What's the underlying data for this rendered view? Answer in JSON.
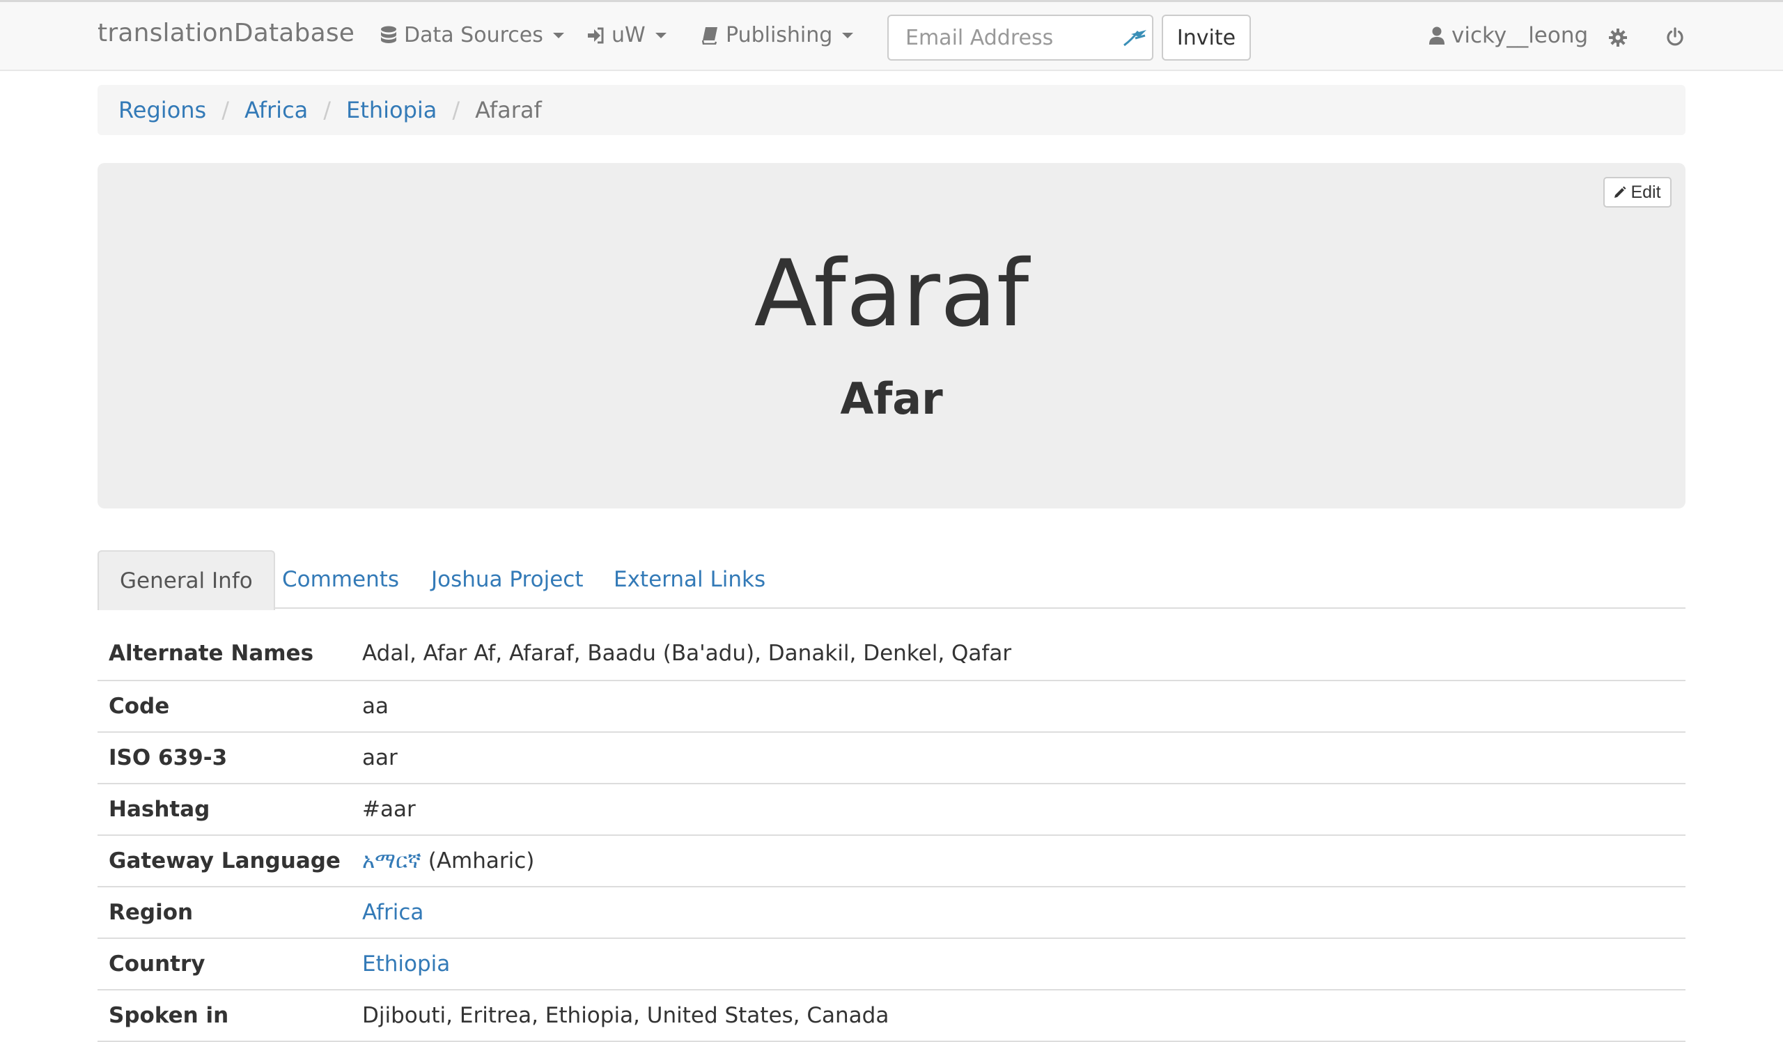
{
  "navbar": {
    "brand": "translationDatabase",
    "menus": [
      {
        "label": "Data Sources",
        "icon": "database-icon"
      },
      {
        "label": "uW",
        "icon": "sign-in-icon"
      },
      {
        "label": "Publishing",
        "icon": "book-icon"
      }
    ],
    "email_placeholder": "Email Address",
    "invite_label": "Invite",
    "username": "vicky__leong"
  },
  "breadcrumb": {
    "items": [
      "Regions",
      "Africa",
      "Ethiopia"
    ],
    "current": "Afaraf"
  },
  "language": {
    "name": "Afaraf",
    "english_name": "Afar",
    "edit_label": "Edit"
  },
  "tabs": [
    "General Info",
    "Comments",
    "Joshua Project",
    "External Links"
  ],
  "info": {
    "rows": [
      {
        "label": "Alternate Names",
        "value": "Adal, Afar Af, Afaraf, Baadu (Ba'adu), Danakil, Denkel, Qafar"
      },
      {
        "label": "Code",
        "value": "aa"
      },
      {
        "label": "ISO 639-3",
        "value": "aar"
      },
      {
        "label": "Hashtag",
        "value": "#aar"
      },
      {
        "label": "Gateway Language",
        "link": "አማርኛ",
        "suffix": " (Amharic)"
      },
      {
        "label": "Region",
        "link": "Africa"
      },
      {
        "label": "Country",
        "link": "Ethiopia"
      },
      {
        "label": "Spoken in",
        "value": "Djibouti, Eritrea, Ethiopia, United States, Canada"
      }
    ]
  },
  "colors": {
    "link": "#337ab7",
    "navbar_bg": "#f8f8f8",
    "jumbotron_bg": "#eeeeee"
  }
}
